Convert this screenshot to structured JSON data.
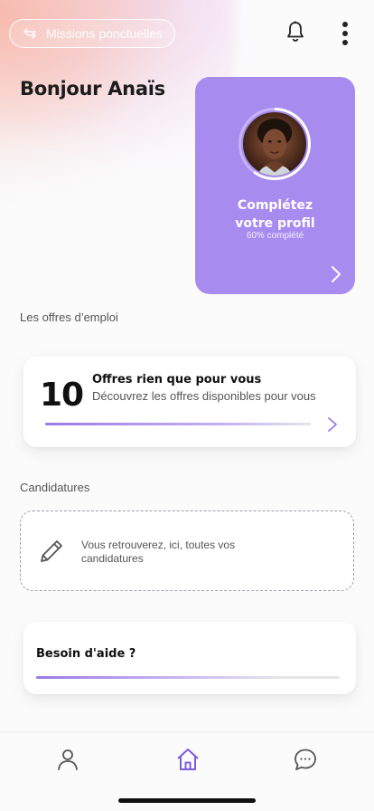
{
  "header": {
    "mode_switch_label": "Missions ponctuelles",
    "notifications_icon": "bell-icon",
    "menu_icon": "more-vertical-icon"
  },
  "greeting": "Bonjour Anaïs",
  "profile_card": {
    "title_line1": "Complétez",
    "title_line2": "votre profil",
    "completion_text": "60% complété",
    "completion_fraction": 0.6,
    "background_color": "#a88bef",
    "chevron_icon": "chevron-right-icon"
  },
  "job_offers": {
    "section_label": "Les offres d’emploi",
    "count": "10",
    "title": "Offres rien que pour vous",
    "description": "Découvrez les offres disponibles pour vous",
    "chevron_icon": "chevron-right-icon"
  },
  "applications": {
    "section_label": "Candidatures",
    "empty_text": "Vous retrouverez, ici, toutes vos candidatures",
    "icon": "pencil-icon"
  },
  "help": {
    "title": "Besoin d'aide ?"
  },
  "bottom_nav": {
    "items": [
      {
        "icon": "user-icon",
        "active": false
      },
      {
        "icon": "home-icon",
        "active": true
      },
      {
        "icon": "chat-icon",
        "active": false
      }
    ],
    "active_color": "#7c5ce0",
    "inactive_color": "#555555"
  }
}
